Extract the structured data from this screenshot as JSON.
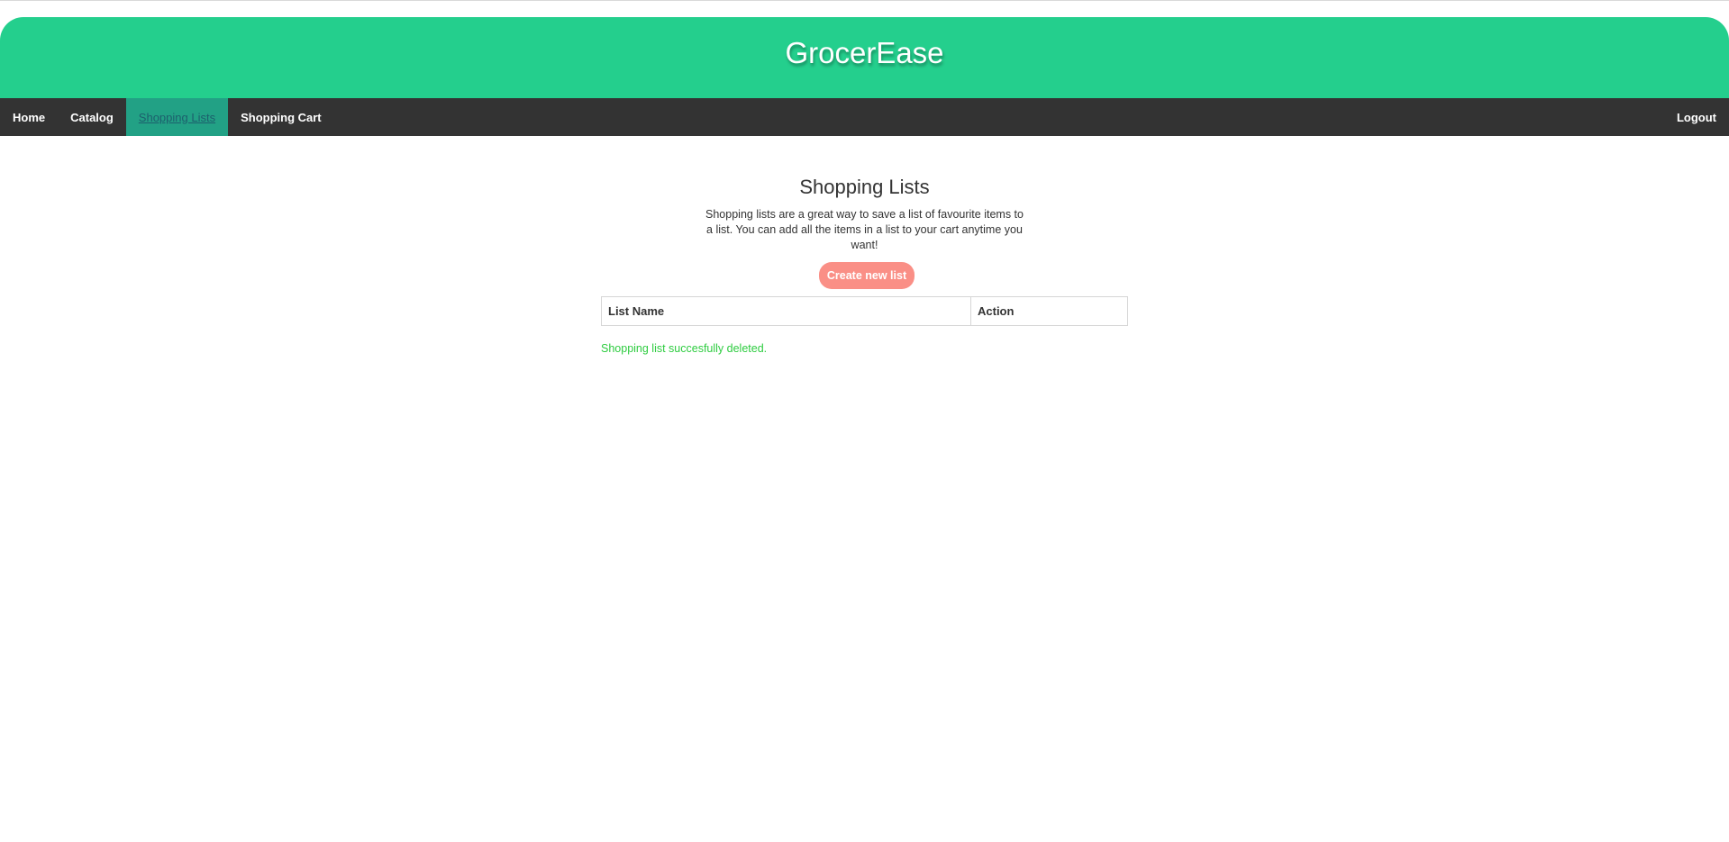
{
  "app": {
    "brand": "GrocerEase"
  },
  "nav": {
    "items": [
      {
        "label": "Home"
      },
      {
        "label": "Catalog"
      },
      {
        "label": "Shopping Lists",
        "active": true
      },
      {
        "label": "Shopping Cart"
      }
    ],
    "logout_label": "Logout"
  },
  "main": {
    "title": "Shopping Lists",
    "intro": "Shopping lists are a great way to save a list of favourite items to a list. You can add all the items in a list to your cart anytime you want!",
    "create_button_label": "Create new list",
    "table": {
      "columns": [
        "List Name",
        "Action"
      ],
      "rows": []
    },
    "status_message": "Shopping list succesfully deleted."
  },
  "colors": {
    "header": "#24cf8d",
    "navbar": "#333333",
    "active_nav": "#22a185",
    "create_button": "#fa8f86",
    "success": "#2ecc40"
  }
}
